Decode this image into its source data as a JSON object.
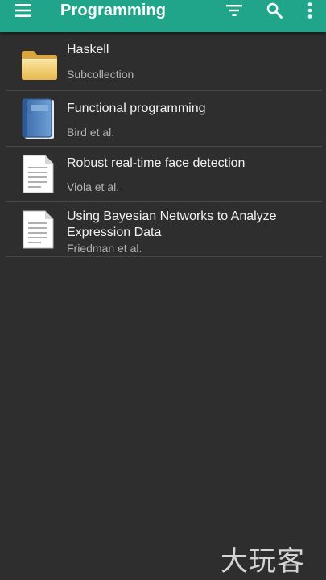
{
  "toolbar": {
    "title": "Programming",
    "menu_icon": "hamburger-menu-icon",
    "filter_icon": "filter-icon",
    "search_icon": "search-icon",
    "more_icon": "more-vert-icon",
    "color": "#20a58a"
  },
  "items": [
    {
      "title": "Haskell",
      "subtitle": "Subcollection",
      "icon": "folder-icon"
    },
    {
      "title": "Functional programming",
      "subtitle": "Bird et al.",
      "icon": "book-icon"
    },
    {
      "title": "Robust real-time face detection",
      "subtitle": "Viola et al.",
      "icon": "document-icon"
    },
    {
      "title": "Using Bayesian Networks to Analyze Expression Data",
      "subtitle": "Friedman et al.",
      "icon": "document-icon"
    }
  ],
  "watermark": {
    "text": "大玩客"
  }
}
